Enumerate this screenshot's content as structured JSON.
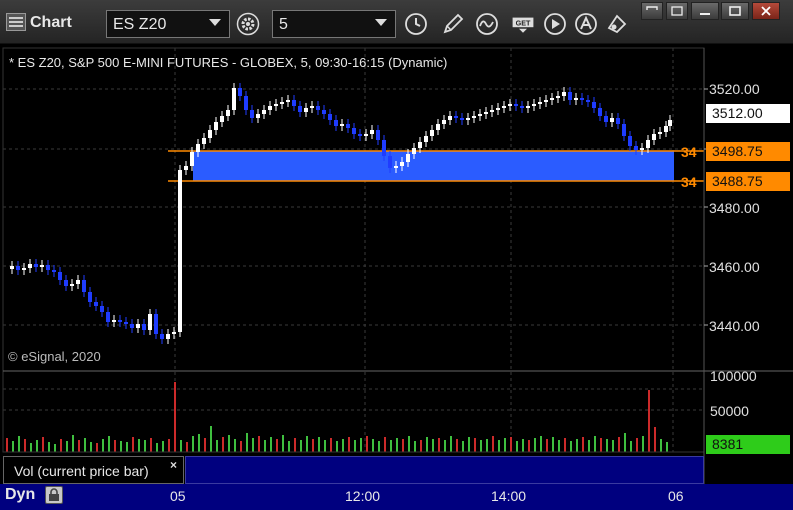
{
  "toolbar": {
    "title": "Chart",
    "symbol_value": "ES Z20",
    "interval_value": "5"
  },
  "chart": {
    "caption": "* ES Z20, S&P 500 E-MINI FUTURES - GLOBEX, 5, 09:30-16:15 (Dynamic)",
    "copyright": "© eSignal, 2020",
    "price_axis_labels": [
      "3520.00",
      "3480.00",
      "3460.00",
      "3440.00"
    ],
    "last_price_tag": "3512.00",
    "level_tags": [
      "3498.75",
      "3488.75"
    ],
    "level_truncated_labels": [
      "34",
      "34"
    ],
    "volume_axis_labels": [
      "100000",
      "50000"
    ],
    "last_volume_tag": "8381",
    "time_labels": [
      "05",
      "12:00",
      "14:00",
      "06"
    ],
    "colors": {
      "zone": "#2b5cff",
      "level_line": "#ff8a00",
      "up_candle": "#ffffff",
      "down_candle": "#1f3cff",
      "volume_up": "#3fbf3f",
      "volume_down": "#cc2a2a",
      "last_price_bg": "#ffffff",
      "level_tag_bg": "#ff8a00",
      "volume_tag_bg": "#2ecc1a"
    }
  },
  "study": {
    "label": "Vol (current price bar)",
    "close_glyph": "×"
  },
  "bottom": {
    "mode_label": "Dyn"
  },
  "icons": [
    "settings-gear-icon",
    "clock-icon",
    "pencil-icon",
    "study-wave-icon",
    "get-data-icon",
    "play-icon",
    "alert-icon",
    "link-icon",
    "restore-icon",
    "minimize-icon",
    "maximize-icon",
    "close-icon",
    "lock-icon"
  ]
}
